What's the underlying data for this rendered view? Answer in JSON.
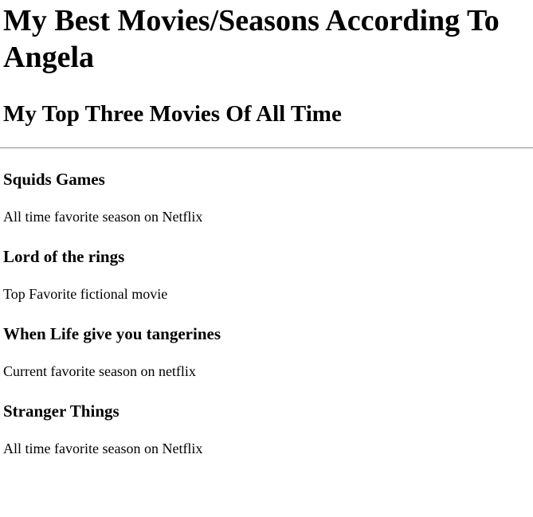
{
  "page": {
    "title": "My Best Movies/Seasons According To Angela",
    "subtitle": "My Top Three Movies Of All Time"
  },
  "entries": [
    {
      "title": "Squids Games",
      "description": "All time favorite season on Netflix"
    },
    {
      "title": "Lord of the rings",
      "description": "Top Favorite fictional movie"
    },
    {
      "title": "When Life give you tangerines",
      "description": "Current favorite season on netflix"
    },
    {
      "title": "Stranger Things",
      "description": "All time favorite season on Netflix"
    }
  ]
}
